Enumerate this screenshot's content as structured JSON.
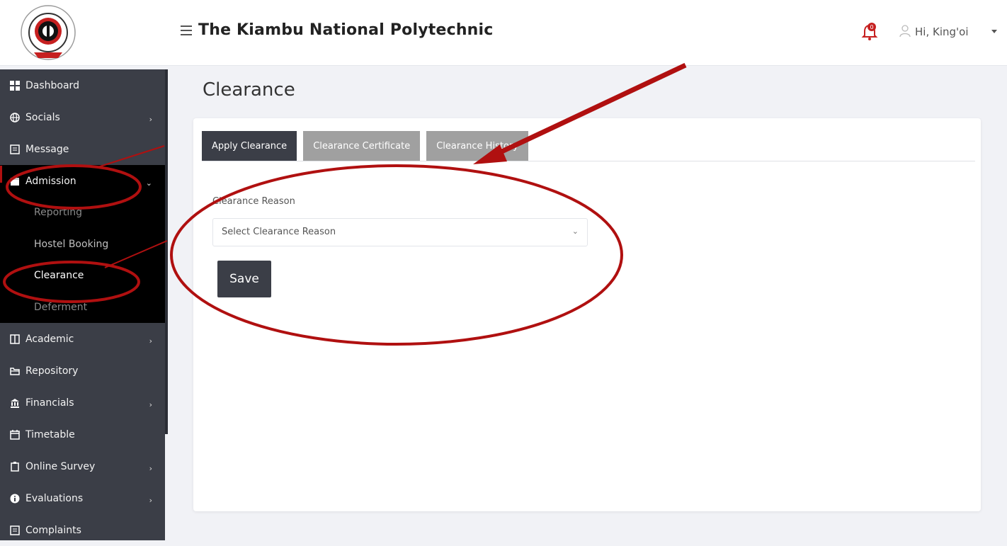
{
  "header": {
    "title": "The Kiambu National Polytechnic",
    "notification_count": "0",
    "user_greeting": "Hi, King'oi"
  },
  "sidebar": {
    "items": [
      {
        "label": "Dashboard",
        "icon": "dashboard-icon"
      },
      {
        "label": "Socials",
        "icon": "globe-icon",
        "has_children": true
      },
      {
        "label": "Message",
        "icon": "message-icon"
      },
      {
        "label": "Admission",
        "icon": "calendar-icon",
        "has_children": true,
        "expanded": true
      },
      {
        "label": "Academic",
        "icon": "book-icon",
        "has_children": true
      },
      {
        "label": "Repository",
        "icon": "folder-icon"
      },
      {
        "label": "Financials",
        "icon": "bank-icon",
        "has_children": true
      },
      {
        "label": "Timetable",
        "icon": "calendar-icon"
      },
      {
        "label": "Online Survey",
        "icon": "clipboard-icon",
        "has_children": true
      },
      {
        "label": "Evaluations",
        "icon": "info-circle-icon",
        "has_children": true
      },
      {
        "label": "Complaints",
        "icon": "message-icon"
      }
    ],
    "admission_submenu": [
      "Reporting",
      "Hostel Booking",
      "Clearance",
      "Deferment"
    ],
    "active_submenu": "Clearance"
  },
  "main": {
    "page_title": "Clearance",
    "tabs": [
      "Apply Clearance",
      "Clearance Certificate",
      "Clearance History"
    ],
    "active_tab": "Apply Clearance",
    "form": {
      "reason_label": "Clearance Reason",
      "reason_select_value": "Select Clearance Reason",
      "save_label": "Save"
    }
  },
  "colors": {
    "sidebar_bg": "#3b3e47",
    "submenu_bg": "#000000",
    "tab_active": "#3b3e47",
    "tab_inactive": "#a0a0a0",
    "annotation_red": "#b01010"
  }
}
